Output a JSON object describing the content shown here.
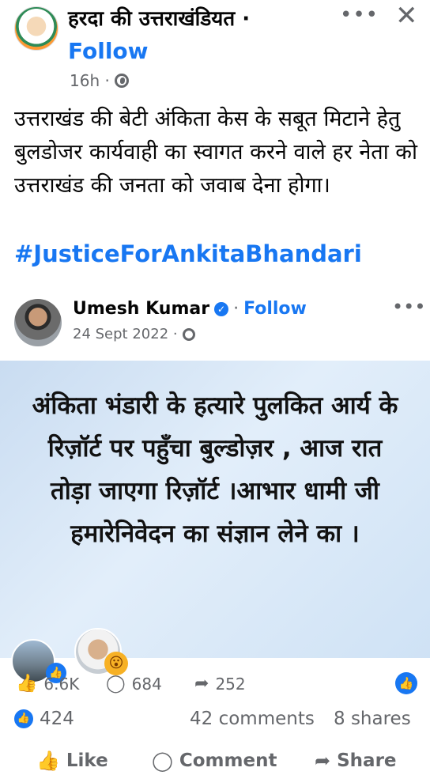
{
  "post": {
    "author": "हरदा की उत्तराखंडियत ·",
    "follow": "Follow",
    "time": "16h ·",
    "text": "उत्तराखंड की बेटी अंकिता केस के सबूत मिटाने हेतु बुलडोजर कार्यवाही का स्वागत करने वाले हर नेता को उत्तराखंड की जनता को जवाब देना होगा।",
    "hashtag": "#JusticeForAnkitaBhandari",
    "more_icon": "•••",
    "close_icon": "✕"
  },
  "shared_post": {
    "author": "Umesh Kumar",
    "follow": "Follow",
    "date": "24 Sept 2022 ·",
    "more_icon": "•••",
    "image_text": "अंकिता भंडारी के हत्यारे पुलकित आर्य के रिज़ॉर्ट पर पहुँचा बुल्डोज़र , आज रात तोड़ा जाएगा रिज़ॉर्ट ।आभार धामी जी हमारेनिवेदन का संज्ञान लेने का ।",
    "likes": "6.6K",
    "comments": "684",
    "shares": "252"
  },
  "summary": {
    "reactions": "424",
    "comments": "42 comments",
    "shares": "8 shares"
  },
  "actions": {
    "like": "Like",
    "comment": "Comment",
    "share": "Share"
  },
  "colors": {
    "accent": "#1877f2",
    "muted_text": "#65676b",
    "image_bg": "#d6e6f6"
  }
}
